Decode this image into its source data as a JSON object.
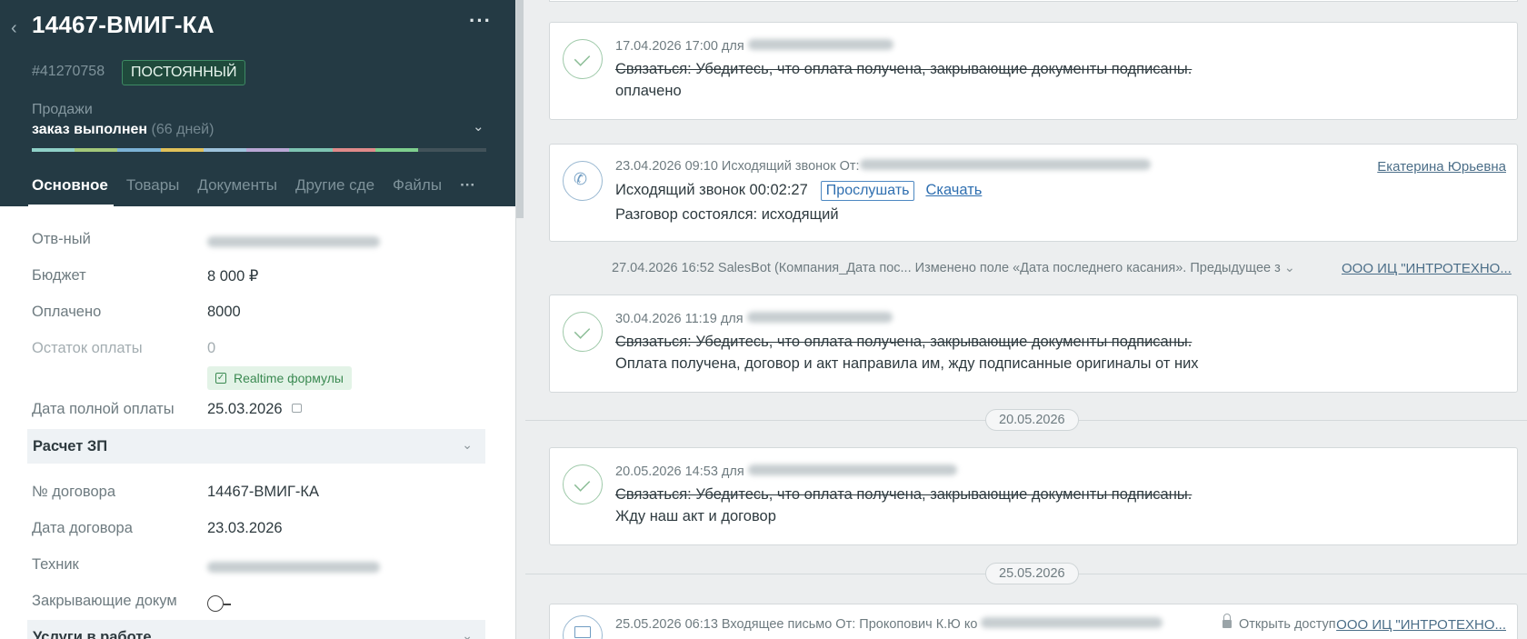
{
  "deal": {
    "back_icon": "chevron-left-icon",
    "title": "14467-ВМИГ-КА",
    "more": "···",
    "id": "#41270758",
    "badge": "ПОСТОЯННЫЙ",
    "pipeline": "Продажи",
    "stage": "заказ выполнен",
    "stage_days": "(66 дней)",
    "progress_colors": [
      "#8fd1c8",
      "#a3c87a",
      "#7cb2d6",
      "#e0c15a",
      "#9ec3dc",
      "#b9a7d5",
      "#7ec4b3",
      "#e08a8a",
      "#7ecf8e"
    ],
    "progress_fill_fraction": 0.85
  },
  "tabs": [
    "Основное",
    "Товары",
    "Документы",
    "Другие сде",
    "Файлы"
  ],
  "tabs_more": "···",
  "fields": {
    "responsible_label": "Отв-ный",
    "budget_label": "Бюджет",
    "budget_value": "8 000 ₽",
    "paid_label": "Оплачено",
    "paid_value": "8000",
    "remaining_label": "Остаток оплаты",
    "remaining_value": "0",
    "realtime_label": "Realtime формулы",
    "full_pay_date_label": "Дата полной оплаты",
    "full_pay_date_value": "25.03.2026",
    "section_salary": "Расчет ЗП",
    "contract_no_label": "№ договора",
    "contract_no_value": "14467-ВМИГ-КА",
    "contract_date_label": "Дата договора",
    "contract_date_value": "23.03.2026",
    "technician_label": "Техник",
    "closing_docs_label": "Закрывающие докум",
    "section_services": "Услуги в работе"
  },
  "feed": {
    "task1": {
      "meta": "17.04.2026 17:00  для",
      "task": "Связаться: Убедитесь, что оплата получена, закрывающие документы подписаны.",
      "result": "оплачено"
    },
    "call": {
      "meta": "23.04.2026 09:10 Исходящий звонок От:",
      "author": "Екатерина Юрьевна",
      "title": "Исходящий звонок 00:02:27",
      "listen": "Прослушать",
      "download": "Скачать",
      "result": "Разговор состоялся: исходящий"
    },
    "system": {
      "text": "27.04.2026 16:52 SalesBot (Компания_Дата пос... Изменено поле «Дата последнего касания». Предыдущее з",
      "company": "ООО ИЦ \"ИНТРОТЕХНО..."
    },
    "task2": {
      "meta": "30.04.2026 11:19  для",
      "task": "Связаться: Убедитесь, что оплата получена, закрывающие документы подписаны.",
      "result": "Оплата получена, договор и акт направила им, жду подписанные оригиналы от них"
    },
    "date1": "20.05.2026",
    "task3": {
      "meta": "20.05.2026 14:53  для",
      "task": "Связаться: Убедитесь, что оплата получена, закрывающие документы подписаны.",
      "result": "Жду наш акт и договор"
    },
    "date2": "25.05.2026",
    "mail": {
      "meta": "25.05.2026 06:13 Входящее письмо От: Прокопович К.Ю ко",
      "access": "Открыть доступ",
      "company": "ООО ИЦ \"ИНТРОТЕХНО..."
    }
  }
}
